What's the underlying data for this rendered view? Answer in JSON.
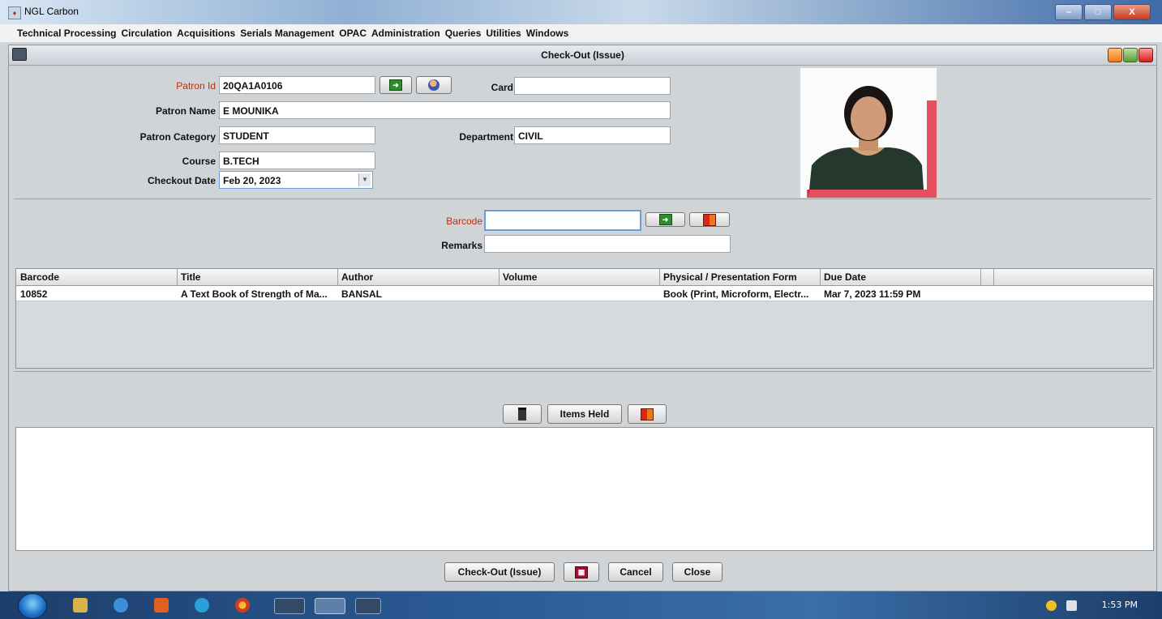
{
  "app": {
    "title": "NGL Carbon"
  },
  "window_controls": {
    "minimize": "–",
    "maximize": "□",
    "close": "X"
  },
  "menubar": [
    "Technical Processing",
    "Circulation",
    "Acquisitions",
    "Serials Management",
    "OPAC",
    "Administration",
    "Queries",
    "Utilities",
    "Windows"
  ],
  "dialog": {
    "title": "Check-Out (Issue)"
  },
  "patron": {
    "id_label": "Patron Id",
    "id_value": "20QA1A0106",
    "card_label": "Card",
    "card_value": "",
    "name_label": "Patron Name",
    "name_value": "E MOUNIKA",
    "category_label": "Patron Category",
    "category_value": "STUDENT",
    "department_label": "Department",
    "department_value": "CIVIL",
    "course_label": "Course",
    "course_value": "B.TECH",
    "checkout_date_label": "Checkout Date",
    "checkout_date_value": "Feb 20, 2023"
  },
  "item_entry": {
    "barcode_label": "Barcode",
    "barcode_value": "",
    "remarks_label": "Remarks",
    "remarks_value": ""
  },
  "table": {
    "columns": [
      "Barcode",
      "Title",
      "Author",
      "Volume",
      "Physical / Presentation Form",
      "Due Date"
    ],
    "rows": [
      [
        "10852",
        "A Text Book of Strength of Ma...",
        "BANSAL",
        "",
        "Book (Print, Microform, Electr...",
        "Mar 7, 2023 11:59 PM"
      ]
    ]
  },
  "middle_buttons": {
    "items_held": "Items Held"
  },
  "footer_buttons": {
    "checkout": "Check-Out (Issue)",
    "cancel": "Cancel",
    "close": "Close"
  },
  "taskbar": {
    "time": "1:53 PM"
  },
  "icons": {
    "go": "green-arrow-icon",
    "patron": "patron-search-icon",
    "book": "book-icon",
    "trash": "delete-icon",
    "calendar": "calendar-icon"
  },
  "colors": {
    "required_label": "#c02b10",
    "title_gradient_end": "#3f6aa8"
  }
}
